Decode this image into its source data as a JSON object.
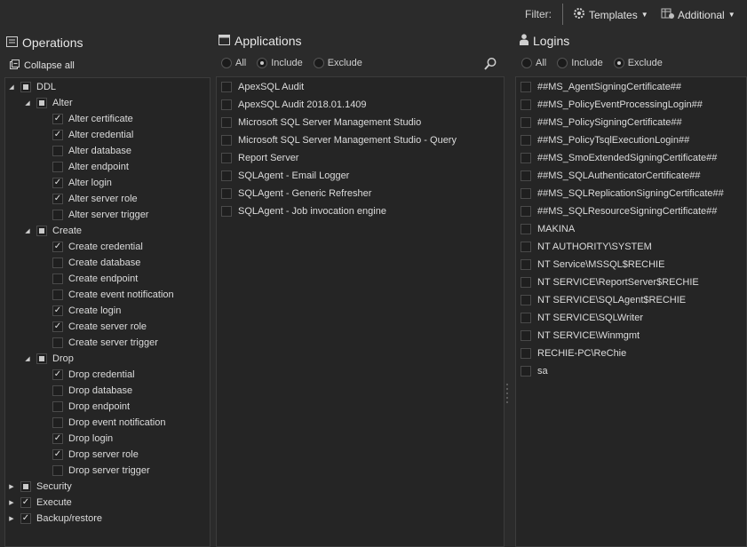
{
  "topbar": {
    "filter_label": "Filter:",
    "templates_label": "Templates",
    "additional_label": "Additional"
  },
  "operations": {
    "title": "Operations",
    "collapse_all_label": "Collapse all",
    "tree": [
      {
        "label": "DDL",
        "level": 0,
        "expander": "open",
        "state": "partial"
      },
      {
        "label": "Alter",
        "level": 1,
        "expander": "open",
        "state": "partial"
      },
      {
        "label": "Alter certificate",
        "level": 2,
        "state": "checked"
      },
      {
        "label": "Alter credential",
        "level": 2,
        "state": "checked"
      },
      {
        "label": "Alter database",
        "level": 2,
        "state": "unchecked"
      },
      {
        "label": "Alter endpoint",
        "level": 2,
        "state": "unchecked"
      },
      {
        "label": "Alter login",
        "level": 2,
        "state": "checked"
      },
      {
        "label": "Alter server role",
        "level": 2,
        "state": "checked"
      },
      {
        "label": "Alter server trigger",
        "level": 2,
        "state": "unchecked"
      },
      {
        "label": "Create",
        "level": 1,
        "expander": "open",
        "state": "partial"
      },
      {
        "label": "Create credential",
        "level": 2,
        "state": "checked"
      },
      {
        "label": "Create database",
        "level": 2,
        "state": "unchecked"
      },
      {
        "label": "Create endpoint",
        "level": 2,
        "state": "unchecked"
      },
      {
        "label": "Create event notification",
        "level": 2,
        "state": "unchecked"
      },
      {
        "label": "Create login",
        "level": 2,
        "state": "checked"
      },
      {
        "label": "Create server role",
        "level": 2,
        "state": "checked"
      },
      {
        "label": "Create server trigger",
        "level": 2,
        "state": "unchecked"
      },
      {
        "label": "Drop",
        "level": 1,
        "expander": "open",
        "state": "partial"
      },
      {
        "label": "Drop credential",
        "level": 2,
        "state": "checked"
      },
      {
        "label": "Drop database",
        "level": 2,
        "state": "unchecked"
      },
      {
        "label": "Drop endpoint",
        "level": 2,
        "state": "unchecked"
      },
      {
        "label": "Drop event notification",
        "level": 2,
        "state": "unchecked"
      },
      {
        "label": "Drop login",
        "level": 2,
        "state": "checked"
      },
      {
        "label": "Drop server role",
        "level": 2,
        "state": "checked"
      },
      {
        "label": "Drop server trigger",
        "level": 2,
        "state": "unchecked"
      },
      {
        "label": "Security",
        "level": 0,
        "expander": "closed",
        "state": "partial"
      },
      {
        "label": "Execute",
        "level": 0,
        "expander": "closed",
        "state": "checked"
      },
      {
        "label": "Backup/restore",
        "level": 0,
        "expander": "closed",
        "state": "checked"
      }
    ]
  },
  "applications": {
    "title": "Applications",
    "radio": {
      "all": "All",
      "include": "Include",
      "exclude": "Exclude",
      "selected": "include"
    },
    "items": [
      "ApexSQL Audit",
      "ApexSQL Audit 2018.01.1409",
      "Microsoft SQL Server Management Studio",
      "Microsoft SQL Server Management Studio - Query",
      "Report Server",
      "SQLAgent - Email Logger",
      "SQLAgent - Generic Refresher",
      "SQLAgent - Job invocation engine"
    ]
  },
  "logins": {
    "title": "Logins",
    "radio": {
      "all": "All",
      "include": "Include",
      "exclude": "Exclude",
      "selected": "exclude"
    },
    "items": [
      "##MS_AgentSigningCertificate##",
      "##MS_PolicyEventProcessingLogin##",
      "##MS_PolicySigningCertificate##",
      "##MS_PolicyTsqlExecutionLogin##",
      "##MS_SmoExtendedSigningCertificate##",
      "##MS_SQLAuthenticatorCertificate##",
      "##MS_SQLReplicationSigningCertificate##",
      "##MS_SQLResourceSigningCertificate##",
      "MAKINA",
      "NT AUTHORITY\\SYSTEM",
      "NT Service\\MSSQL$RECHIE",
      "NT SERVICE\\ReportServer$RECHIE",
      "NT SERVICE\\SQLAgent$RECHIE",
      "NT SERVICE\\SQLWriter",
      "NT SERVICE\\Winmgmt",
      "RECHIE-PC\\ReChie",
      "sa"
    ]
  }
}
